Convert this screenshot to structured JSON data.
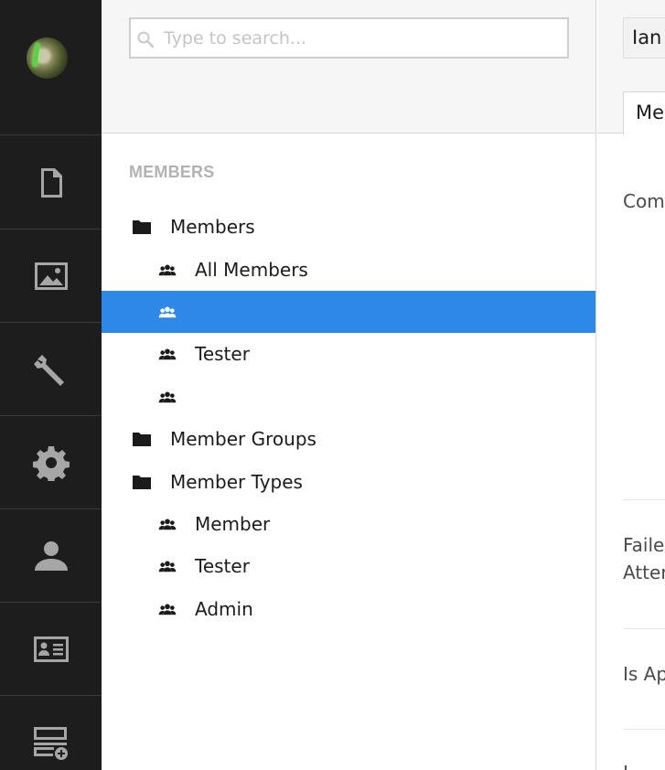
{
  "sections": {
    "avatar_alt": "",
    "items": [
      {
        "icon": "document-icon",
        "name": "section-content"
      },
      {
        "icon": "image-icon",
        "name": "section-media"
      },
      {
        "icon": "wrench-icon",
        "name": "section-settings"
      },
      {
        "icon": "gear-icon",
        "name": "section-packages"
      },
      {
        "icon": "user-icon",
        "name": "section-users"
      },
      {
        "icon": "id-card-icon",
        "name": "section-members"
      },
      {
        "icon": "form-add-icon",
        "name": "section-forms"
      }
    ]
  },
  "search": {
    "placeholder": "Type to search...",
    "value": ""
  },
  "tree": {
    "title": "MEMBERS",
    "nodes": [
      {
        "label": "Members",
        "icon": "folder-icon",
        "level": 0,
        "selected": false
      },
      {
        "label": "All Members",
        "icon": "members-icon",
        "level": 1,
        "selected": false
      },
      {
        "label": "",
        "icon": "members-icon",
        "level": 1,
        "selected": true
      },
      {
        "label": "Tester",
        "icon": "members-icon",
        "level": 1,
        "selected": false
      },
      {
        "label": "",
        "icon": "members-icon",
        "level": 1,
        "selected": false
      },
      {
        "label": "Member Groups",
        "icon": "folder-icon",
        "level": 0,
        "selected": false
      },
      {
        "label": "Member Types",
        "icon": "folder-icon",
        "level": 0,
        "selected": false
      },
      {
        "label": "Member",
        "icon": "members-icon",
        "level": 1,
        "selected": false
      },
      {
        "label": "Tester",
        "icon": "members-icon",
        "level": 1,
        "selected": false
      },
      {
        "label": "Admin",
        "icon": "members-icon",
        "level": 1,
        "selected": false
      }
    ]
  },
  "editor": {
    "name_value": "Ian",
    "tab_label": "Me",
    "properties": [
      "Com",
      "Faile",
      "Atter",
      "Is Ap",
      "I"
    ]
  },
  "colors": {
    "sidebar": "#1d1d1d",
    "selected": "#2e88e7",
    "icon": "#a6a6a6"
  }
}
